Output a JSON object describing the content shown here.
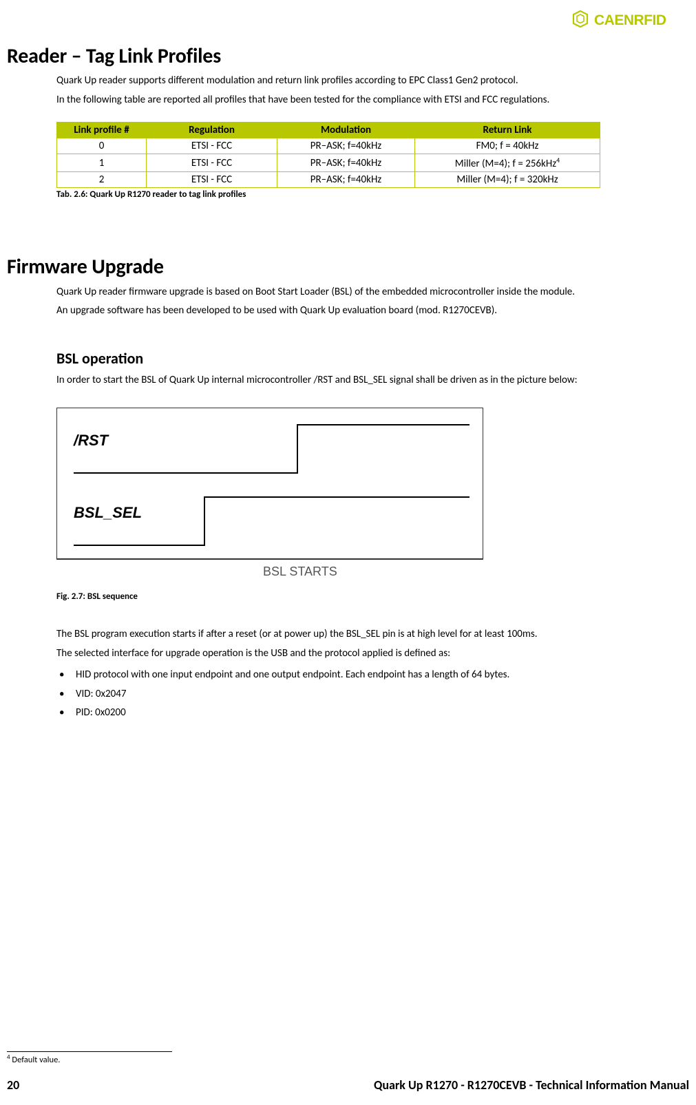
{
  "logo_text": "CAENRFID",
  "section1": {
    "heading": "Reader – Tag Link Profiles",
    "p1": "Quark Up reader supports different modulation and return link profiles according to EPC Class1 Gen2 protocol.",
    "p2": "In the following table are reported all profiles that have been tested for the compliance with ETSI and FCC regulations.",
    "table": {
      "headers": [
        "Link profile #",
        "Regulation",
        "Modulation",
        "Return Link"
      ],
      "rows": [
        [
          "0",
          "ETSI - FCC",
          "PR–ASK; f=40kHz",
          "FM0; f = 40kHz"
        ],
        [
          "1",
          "ETSI - FCC",
          "PR–ASK; f=40kHz",
          "Miller (M=4); f = 256kHz"
        ],
        [
          "2",
          "ETSI - FCC",
          "PR–ASK; f=40kHz",
          "Miller (M=4); f = 320kHz"
        ]
      ],
      "row1_footnote_marker": "4"
    },
    "caption": "Tab. 2.6: Quark Up R1270 reader to tag link profiles"
  },
  "section2": {
    "heading": "Firmware Upgrade",
    "p1": "Quark Up reader firmware upgrade is based on Boot Start Loader (BSL) of the embedded microcontroller inside the module.",
    "p2": "An upgrade software has been developed to be used with Quark Up evaluation board (mod. R1270CEVB).",
    "subheading": "BSL operation",
    "p3": "In order to start the BSL of Quark Up internal microcontroller /RST and BSL_SEL signal shall be driven as in the picture below:",
    "diagram": {
      "label_rst": "/RST",
      "label_bsl_sel": "BSL_SEL",
      "label_start": "BSL STARTS"
    },
    "fig_caption": "Fig. 2.7: BSL sequence",
    "p4": "The BSL program execution starts if after a reset (or at power up) the BSL_SEL pin is at high level for at least 100ms.",
    "p5": "The selected interface for upgrade operation is the USB and the protocol applied is defined as:",
    "bullets": [
      "HID protocol with one input endpoint and one output endpoint. Each endpoint has a length of 64 bytes.",
      "VID: 0x2047",
      "PID: 0x0200"
    ]
  },
  "footnote": {
    "marker": "4",
    "text": " Default value."
  },
  "footer": {
    "page": "20",
    "title": "Quark Up R1270 - R1270CEVB - Technical Information Manual"
  }
}
